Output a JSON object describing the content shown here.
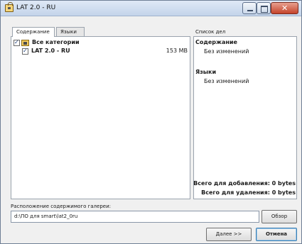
{
  "window": {
    "title": "LAT 2.0 - RU",
    "icon": "package-icon",
    "controls": [
      "minimize",
      "maximize",
      "close"
    ]
  },
  "tabs": [
    {
      "label": "Содержание",
      "active": true
    },
    {
      "label": "Языки",
      "active": false
    }
  ],
  "tree": {
    "items": [
      {
        "label": "Все категории",
        "checked": true,
        "icon": "folder-icon",
        "size": ""
      },
      {
        "label": "LAT 2.0 - RU",
        "checked": true,
        "icon": "",
        "size": "153 MB"
      }
    ]
  },
  "todo": {
    "title": "Список дел",
    "sections": [
      {
        "heading": "Содержание",
        "text": "Без изменений"
      },
      {
        "heading": "Языки",
        "text": "Без изменений"
      }
    ],
    "total_add": "Всего для добавления: 0 bytes",
    "total_remove": "Всего для удаления: 0 bytes"
  },
  "gallery": {
    "label": "Расположение содержимого галереи:",
    "path": "d:\\ПО для smart\\lat2_0ru",
    "browse_label": "Обзор"
  },
  "footer": {
    "next_label": "Далее >>",
    "cancel_label": "Отмена"
  }
}
